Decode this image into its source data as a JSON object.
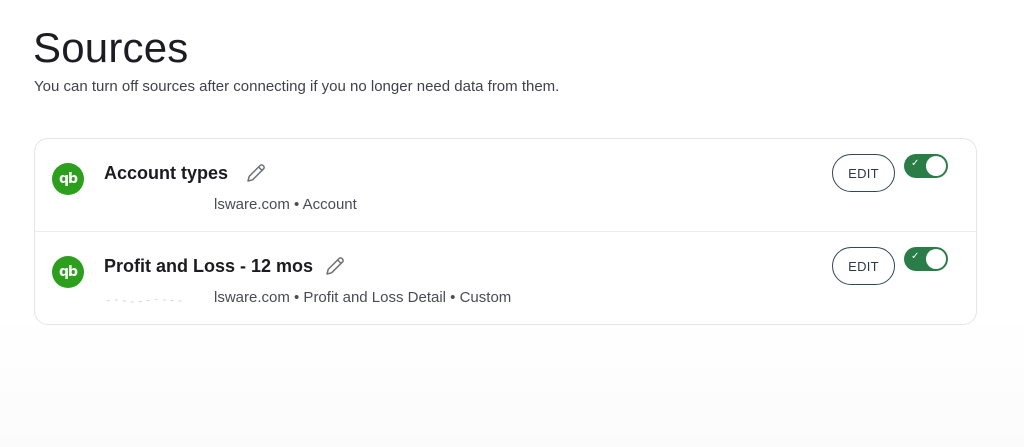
{
  "page": {
    "title": "Sources",
    "subtitle": "You can turn off sources after connecting if you no longer need data from them."
  },
  "sources": [
    {
      "logo_text": "qb",
      "name": "Account types",
      "meta": "lsware.com • Account",
      "edit_label": "EDIT",
      "enabled": true,
      "check": "✓"
    },
    {
      "logo_text": "qb",
      "name": "Profit and Loss - 12 mos",
      "meta": "lsware.com • Profit and Loss Detail • Custom",
      "edit_label": "EDIT",
      "enabled": true,
      "check": "✓"
    }
  ],
  "icons": {
    "logo": "quickbooks-logo-icon",
    "rename": "pencil-icon",
    "toggle_check": "check-icon"
  },
  "colors": {
    "quickbooks_green": "#2ca01c",
    "toggle_on": "#2a7d47",
    "edit_border": "#2f4a55"
  }
}
